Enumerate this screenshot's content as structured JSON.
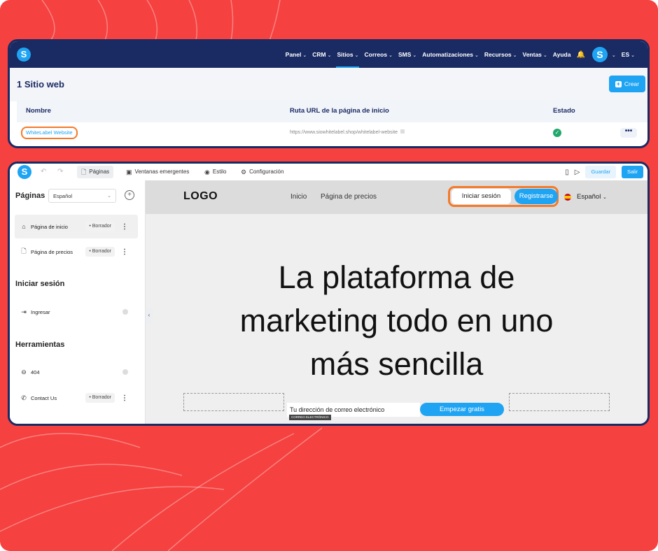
{
  "colors": {
    "background": "#f5413f",
    "navy": "#1a2a63",
    "accent": "#1fa4f3",
    "highlight": "#f47a2a",
    "success": "#21a86a"
  },
  "topnav": {
    "logo": "S",
    "items": [
      {
        "label": "Panel"
      },
      {
        "label": "CRM"
      },
      {
        "label": "Sitios"
      },
      {
        "label": "Correos"
      },
      {
        "label": "SMS"
      },
      {
        "label": "Automatizaciones"
      },
      {
        "label": "Recursos"
      },
      {
        "label": "Ventas"
      }
    ],
    "help": "Ayuda",
    "avatar": "S",
    "lang": "ES"
  },
  "sites": {
    "title": "1 Sitio web",
    "create_label": "Crear",
    "columns": [
      "Nombre",
      "Ruta URL de la página de inicio",
      "Estado"
    ],
    "rows": [
      {
        "name": "WhiteLabel Website",
        "url": "https://www.siowhitelabel.shop/whitelabel-website",
        "status": "published",
        "more": "•••"
      }
    ]
  },
  "editor": {
    "logo": "S",
    "undo_icon": "↶",
    "redo_icon": "↷",
    "tabs": [
      {
        "label": "Páginas",
        "icon": "page-icon"
      },
      {
        "label": "Ventanas emergentes",
        "icon": "popup-icon"
      },
      {
        "label": "Estilo",
        "icon": "palette-icon"
      },
      {
        "label": "Configuración",
        "icon": "gear-icon"
      }
    ],
    "save_label": "Guardar",
    "exit_label": "Salir"
  },
  "sidebar": {
    "pages_title": "Páginas",
    "language": "Español",
    "pages": [
      {
        "label": "Página de inicio",
        "badge": "• Borrador"
      },
      {
        "label": "Página de precios",
        "badge": "• Borrador"
      }
    ],
    "login_title": "Iniciar sesión",
    "login_pages": [
      {
        "label": "Ingresar"
      }
    ],
    "tools_title": "Herramientas",
    "tools": [
      {
        "label": "404",
        "badge": ""
      },
      {
        "label": "Contact Us",
        "badge": "• Borrador"
      }
    ]
  },
  "site": {
    "logo": "LOGO",
    "nav": [
      "Inicio",
      "Página de precios"
    ],
    "login_label": "Iniciar sesión",
    "register_label": "Registrarse",
    "language": "Español",
    "hero_lines": [
      "La plataforma de",
      "marketing todo en uno",
      "más sencilla"
    ],
    "email_placeholder": "Tu dirección de correo electrónico",
    "email_tag": "CORREO ELECTRÓNICO",
    "cta_label": "Empezar gratis"
  }
}
